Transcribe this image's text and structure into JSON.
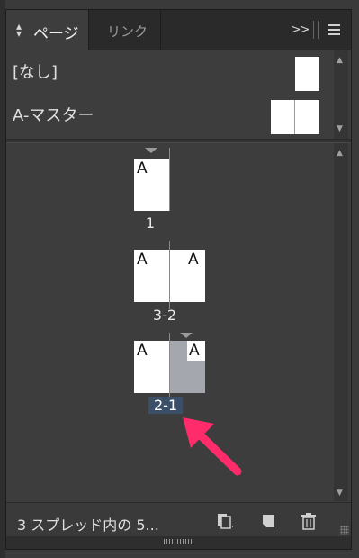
{
  "tabs": [
    {
      "label": "ページ",
      "active": true
    },
    {
      "label": "リンク",
      "active": false
    }
  ],
  "masters": [
    {
      "name": "[なし]"
    },
    {
      "name": "A-マスター"
    }
  ],
  "page_letter": "A",
  "pages": [
    {
      "label": "1"
    },
    {
      "label": "3-2"
    },
    {
      "label": "2-1",
      "selected": true
    }
  ],
  "footer": {
    "status": "3 スプレッド内の 5..."
  },
  "colors": {
    "panel": "#3d3d3d",
    "selected_label_bg": "#3b5068",
    "selected_page": "#a4a8ae",
    "arrow": "#ff2b6b"
  }
}
